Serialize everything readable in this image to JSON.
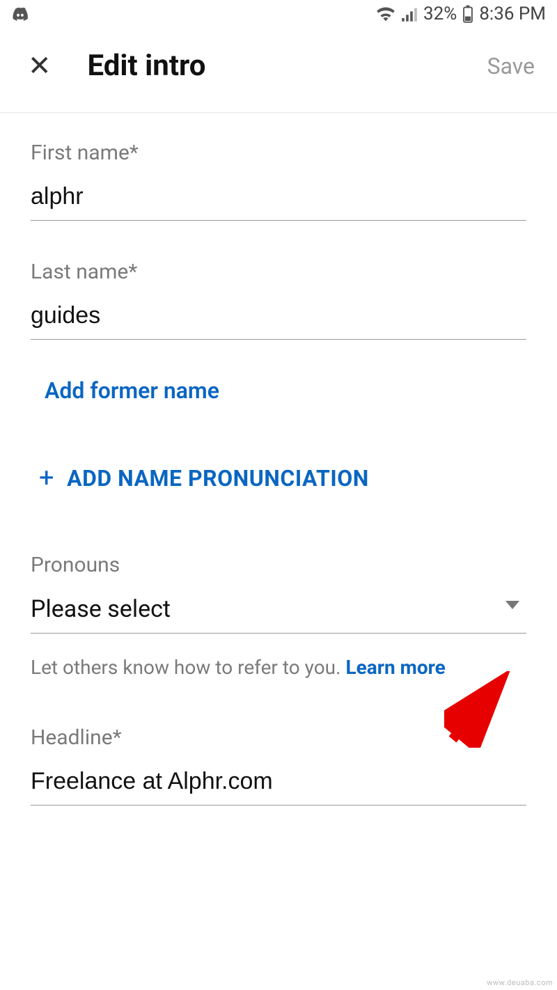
{
  "status_bar": {
    "battery_percent": "32%",
    "time": "8:36 PM"
  },
  "header": {
    "title": "Edit intro",
    "save_label": "Save"
  },
  "form": {
    "first_name": {
      "label": "First name*",
      "value": "alphr"
    },
    "last_name": {
      "label": "Last name*",
      "value": "guides"
    },
    "former_name_link": "Add former name",
    "add_pronunciation": "ADD NAME PRONUNCIATION",
    "pronouns": {
      "label": "Pronouns",
      "value": "Please select",
      "helper_text": "Let others know how to refer to you. ",
      "learn_more": "Learn more"
    },
    "headline": {
      "label": "Headline*",
      "value": "Freelance at Alphr.com"
    }
  },
  "watermark": "www.deuaba.com"
}
